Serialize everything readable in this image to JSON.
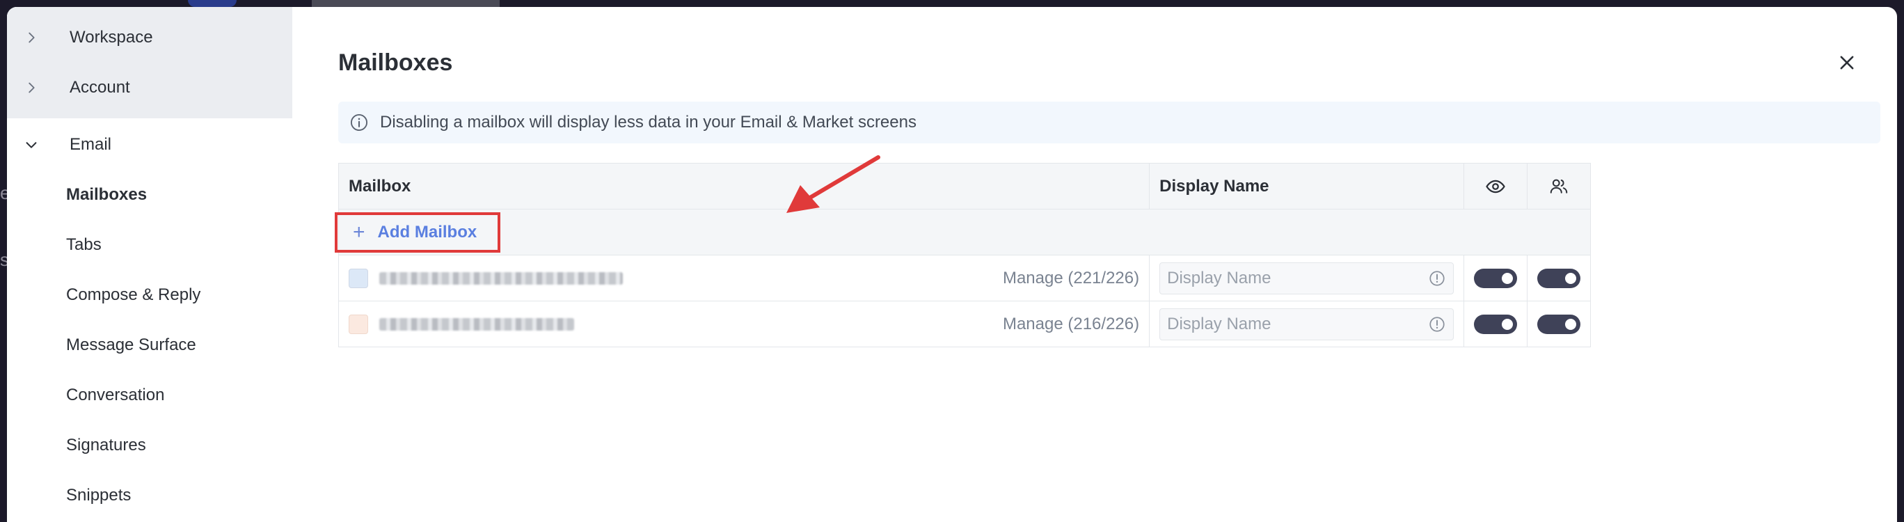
{
  "sidebar": {
    "collapsed_items": [
      {
        "label": "Workspace"
      },
      {
        "label": "Account"
      }
    ],
    "email_section": {
      "label": "Email",
      "items": [
        {
          "label": "Mailboxes",
          "active": true
        },
        {
          "label": "Tabs",
          "active": false
        },
        {
          "label": "Compose & Reply",
          "active": false
        },
        {
          "label": "Message Surface",
          "active": false
        },
        {
          "label": "Conversation",
          "active": false
        },
        {
          "label": "Signatures",
          "active": false
        },
        {
          "label": "Snippets",
          "active": false
        }
      ]
    }
  },
  "main": {
    "title": "Mailboxes",
    "info_banner": "Disabling a mailbox will display less data in your Email & Market screens",
    "table": {
      "headers": {
        "mailbox": "Mailbox",
        "display_name": "Display Name",
        "visibility_icon": "eye-icon",
        "shared_icon": "users-icon"
      },
      "add_label": "Add Mailbox",
      "rows": [
        {
          "swatch_color": "#dce8f7",
          "manage_label": "Manage (221/226)",
          "display_name_placeholder": "Display Name",
          "visible_on": true,
          "shared_on": true
        },
        {
          "swatch_color": "#fbe9e0",
          "manage_label": "Manage (216/226)",
          "display_name_placeholder": "Display Name",
          "visible_on": true,
          "shared_on": true
        }
      ]
    }
  },
  "colors": {
    "accent_link": "#5a7fe0",
    "toggle_on": "#3f4258",
    "annotation_red": "#e03a3a"
  }
}
